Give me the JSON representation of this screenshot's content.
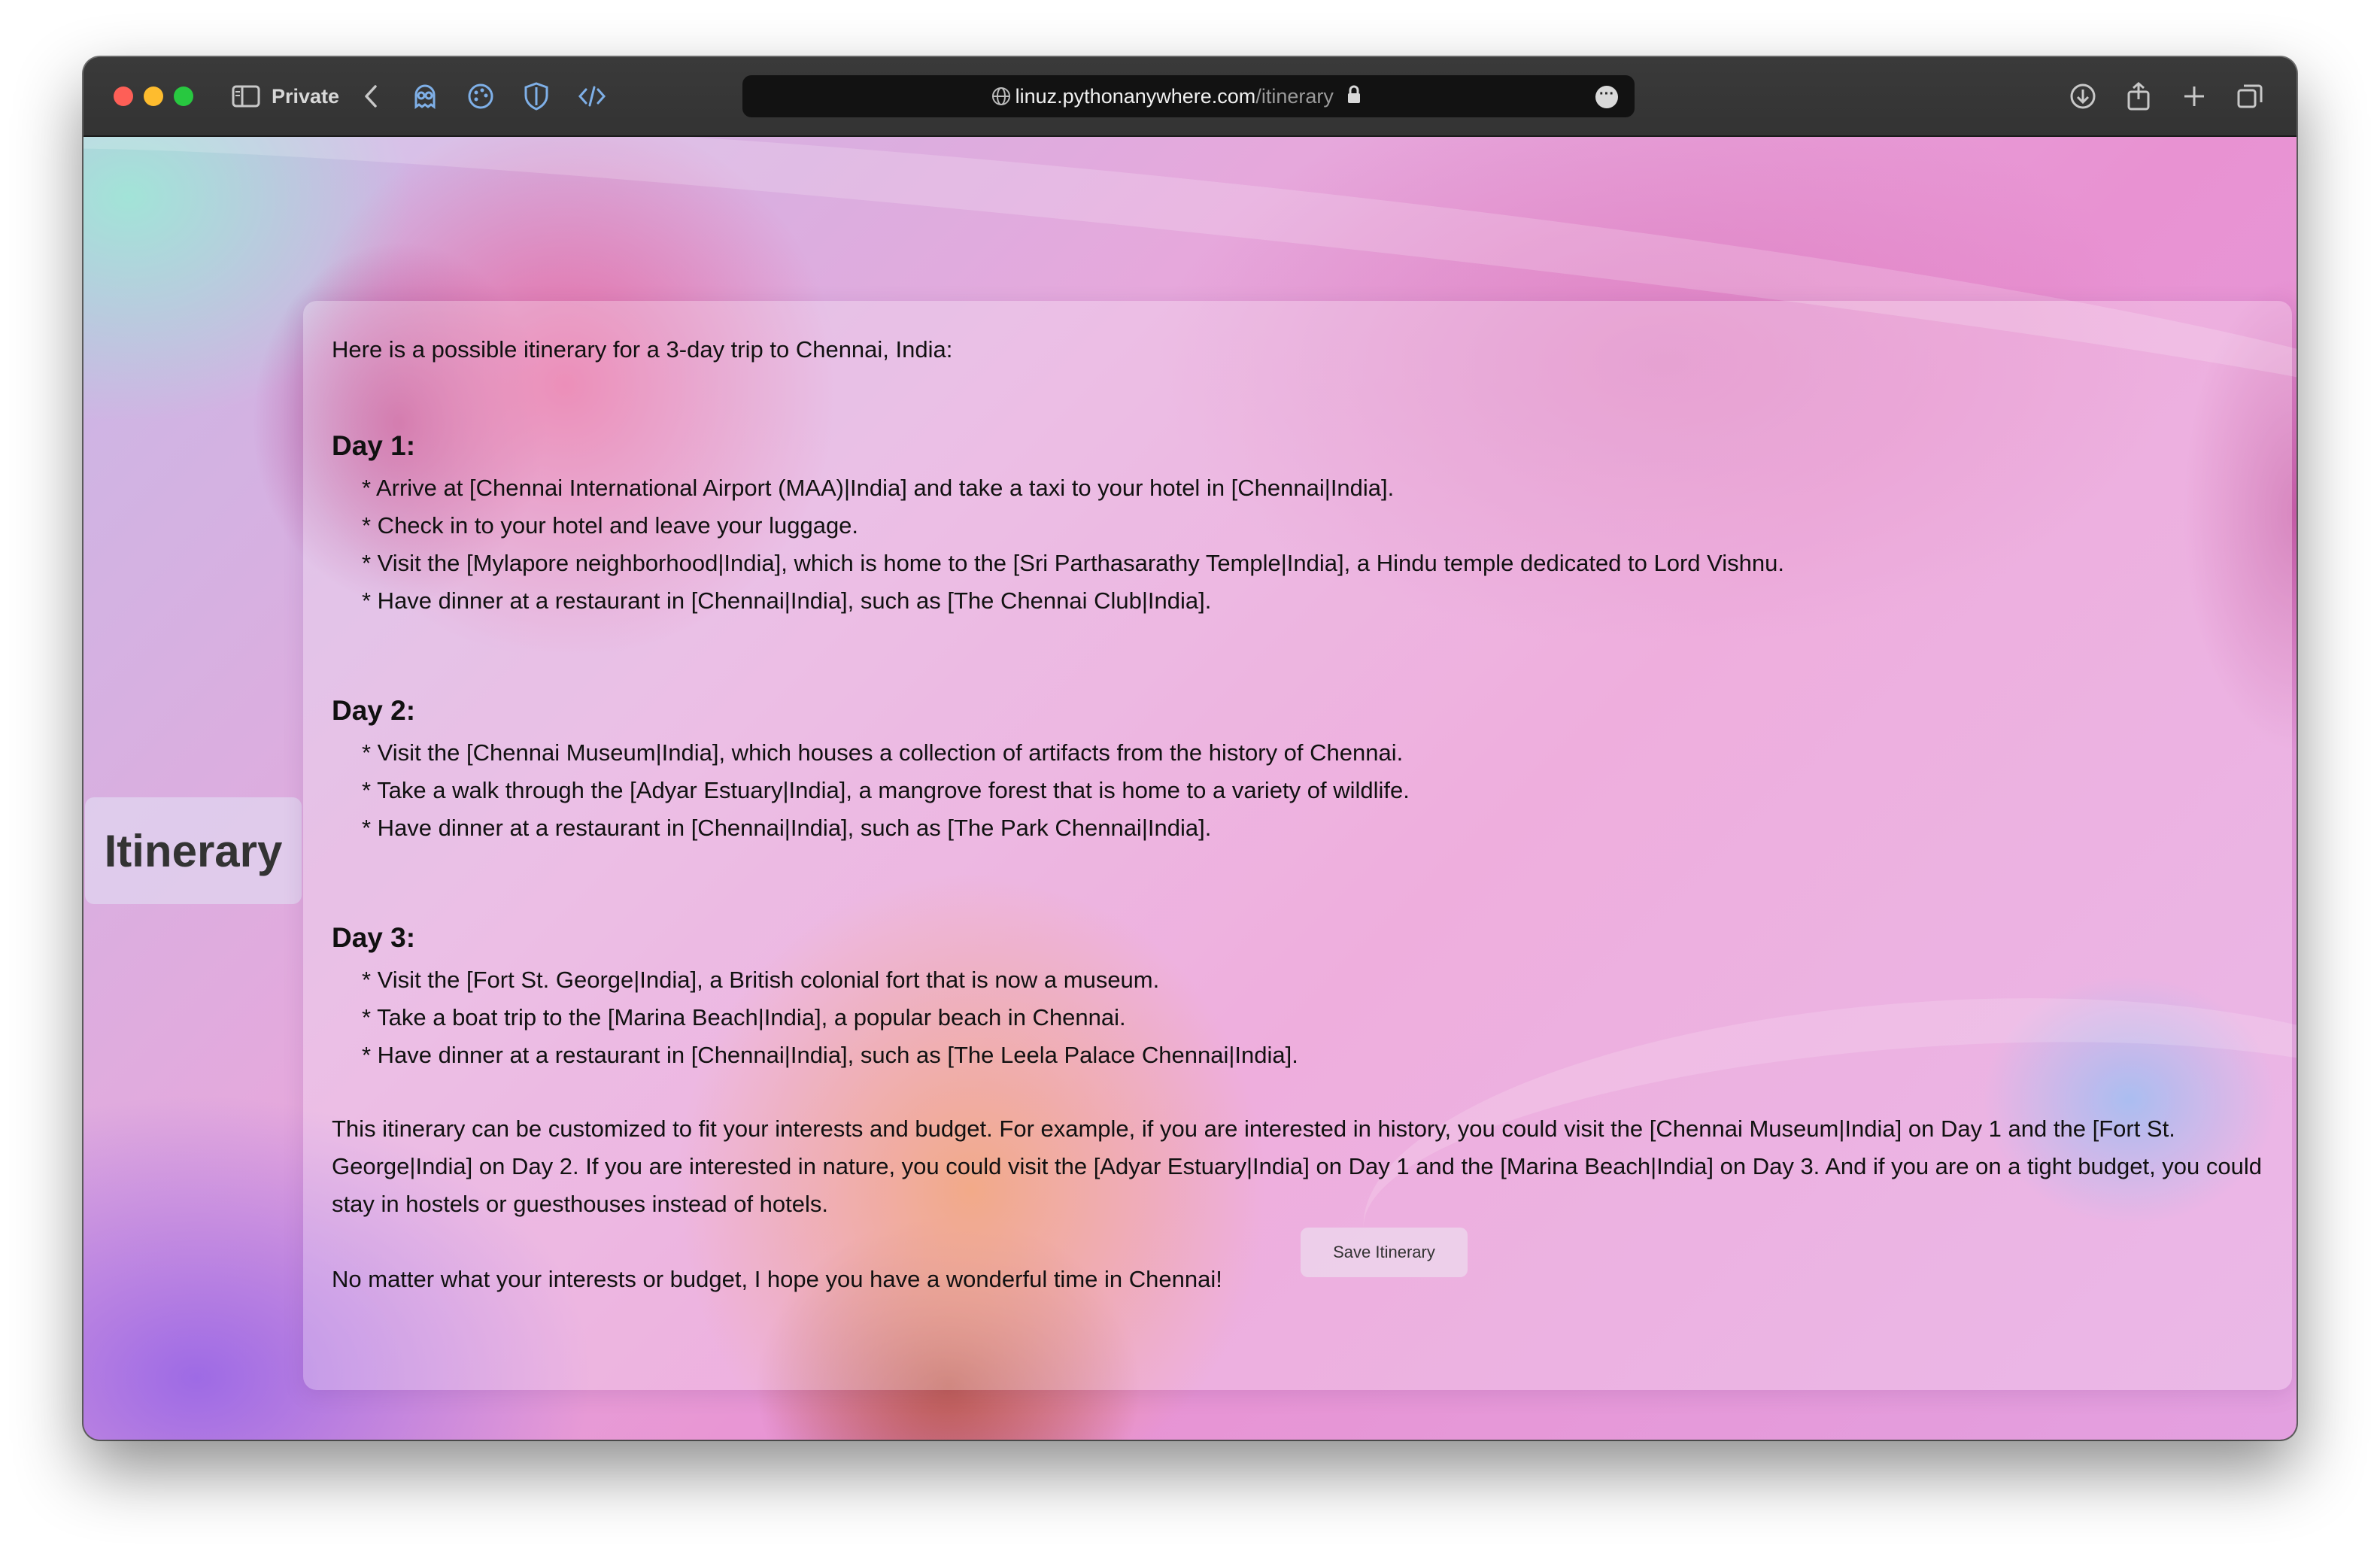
{
  "browser": {
    "private_label": "Private",
    "url_domain": "linuz.pythonanywhere.com",
    "url_path": "/itinerary",
    "toolbar_icons": [
      "sidebar-icon",
      "back-chevron-icon",
      "ghost-extension-icon",
      "palette-extension-icon",
      "shield-extension-icon",
      "code-extension-icon",
      "download-icon",
      "share-icon",
      "new-tab-plus-icon",
      "tab-overview-icon"
    ]
  },
  "page": {
    "side_title": "Itinerary",
    "intro": "Here is a possible itinerary for a 3-day trip to Chennai, India:",
    "days": [
      {
        "heading": "Day 1:",
        "items": [
          "* Arrive at [Chennai International Airport (MAA)|India] and take a taxi to your hotel in [Chennai|India].",
          "* Check in to your hotel and leave your luggage.",
          "* Visit the [Mylapore neighborhood|India], which is home to the [Sri Parthasarathy Temple|India], a Hindu temple dedicated to Lord Vishnu.",
          "* Have dinner at a restaurant in [Chennai|India], such as [The Chennai Club|India]."
        ]
      },
      {
        "heading": "Day 2:",
        "items": [
          "* Visit the [Chennai Museum|India], which houses a collection of artifacts from the history of Chennai.",
          "* Take a walk through the [Adyar Estuary|India], a mangrove forest that is home to a variety of wildlife.",
          "* Have dinner at a restaurant in [Chennai|India], such as [The Park Chennai|India]."
        ]
      },
      {
        "heading": "Day 3:",
        "items": [
          "* Visit the [Fort St. George|India], a British colonial fort that is now a museum.",
          "* Take a boat trip to the [Marina Beach|India], a popular beach in Chennai.",
          "* Have dinner at a restaurant in [Chennai|India], such as [The Leela Palace Chennai|India]."
        ]
      }
    ],
    "customize_paragraph": "This itinerary can be customized to fit your interests and budget. For example, if you are interested in history, you could visit the [Chennai Museum|India] on Day 1 and the [Fort St. George|India] on Day 2. If you are interested in nature, you could visit the [Adyar Estuary|India] on Day 1 and the [Marina Beach|India] on Day 3. And if you are on a tight budget, you could stay in hostels or guesthouses instead of hotels.",
    "closing_paragraph": "No matter what your interests or budget, I hope you have a wonderful time in Chennai!",
    "save_button_label": "Save Itinerary"
  },
  "colors": {
    "traffic_red": "#fe5f57",
    "traffic_yellow": "#febc2e",
    "traffic_green": "#28c840",
    "toolbar_bg": "#363636",
    "url_bar_bg": "#121212"
  }
}
